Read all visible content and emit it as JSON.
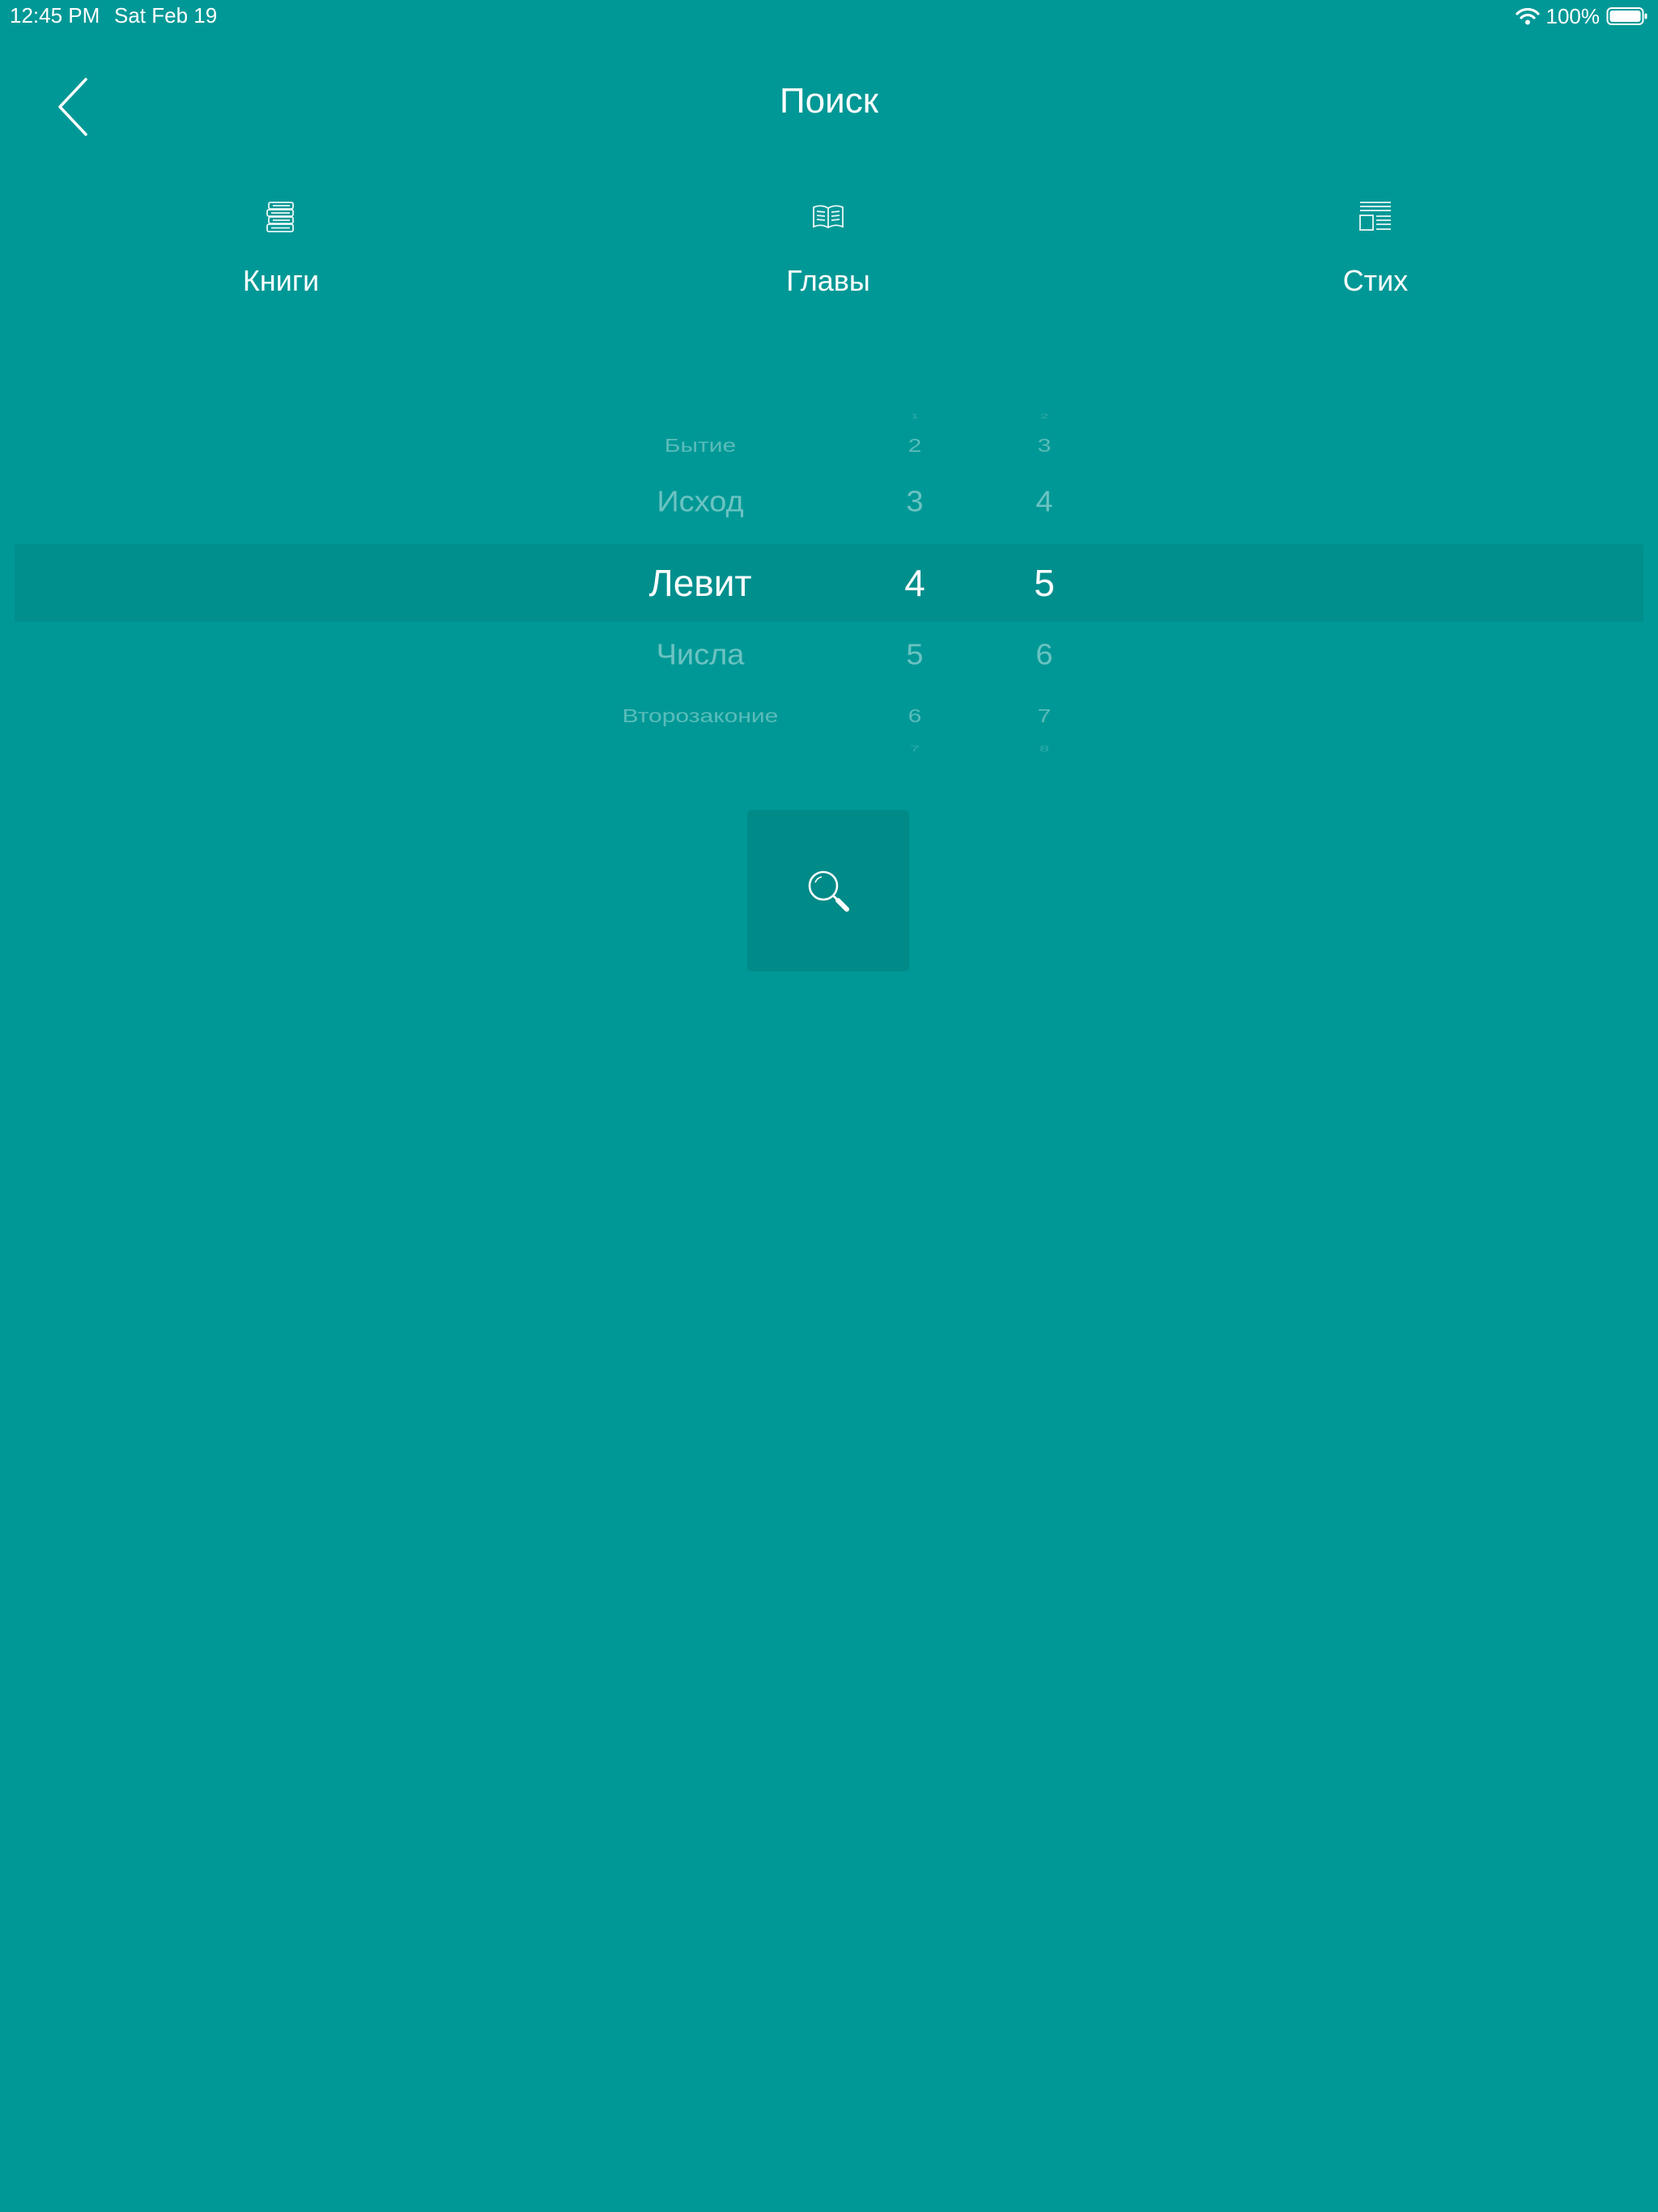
{
  "status_bar": {
    "time": "12:45 PM",
    "date": "Sat Feb 19",
    "battery": "100%"
  },
  "header": {
    "title": "Поиск",
    "back_icon": "chevron-left-icon"
  },
  "tabs": [
    {
      "label": "Книги",
      "icon": "books-stack-icon"
    },
    {
      "label": "Главы",
      "icon": "open-book-icon"
    },
    {
      "label": "Стих",
      "icon": "article-icon"
    }
  ],
  "picker": {
    "books": [
      "Бытие",
      "Исход",
      "Левит",
      "Числа",
      "Второзаконие"
    ],
    "chapters": [
      "1",
      "2",
      "3",
      "4",
      "5",
      "6",
      "7"
    ],
    "verses": [
      "2",
      "3",
      "4",
      "5",
      "6",
      "7",
      "8"
    ],
    "selected": {
      "book": "Левит",
      "chapter": "4",
      "verse": "5"
    }
  },
  "search_button": {
    "icon": "search-icon"
  },
  "colors": {
    "background": "#009896",
    "button": "#008a88",
    "text": "#ffffff"
  }
}
